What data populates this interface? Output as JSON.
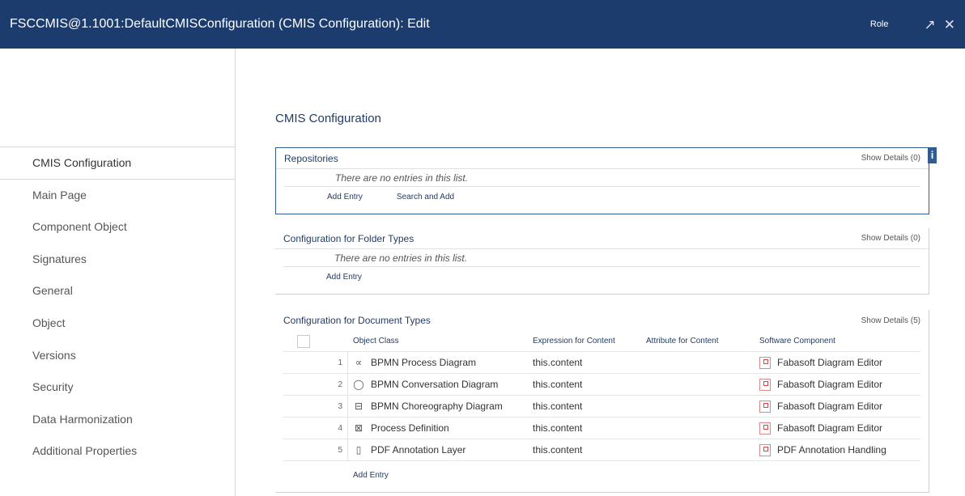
{
  "window": {
    "title": "FSCCMIS@1.1001:DefaultCMISConfiguration (CMIS Configuration): Edit",
    "role_label": "Role",
    "expand_icon": "↗",
    "close_icon": "✕"
  },
  "sidebar": {
    "items": [
      {
        "label": "CMIS Configuration",
        "active": true
      },
      {
        "label": "Main Page"
      },
      {
        "label": "Component Object"
      },
      {
        "label": "Signatures"
      },
      {
        "label": "General"
      },
      {
        "label": "Object"
      },
      {
        "label": "Versions"
      },
      {
        "label": "Security"
      },
      {
        "label": "Data Harmonization"
      },
      {
        "label": "Additional Properties"
      }
    ]
  },
  "main": {
    "page_title": "CMIS Configuration",
    "repositories": {
      "title": "Repositories",
      "details": "Show Details (0)",
      "empty": "There are no entries in this list.",
      "add_entry": "Add Entry",
      "search_add": "Search and Add",
      "info_icon": "i"
    },
    "folder_types": {
      "title": "Configuration for Folder Types",
      "details": "Show Details (0)",
      "empty": "There are no entries in this list.",
      "add_entry": "Add Entry"
    },
    "document_types": {
      "title": "Configuration for Document Types",
      "details": "Show Details (5)",
      "columns": {
        "object_class": "Object Class",
        "expression": "Expression for Content",
        "attribute": "Attribute for Content",
        "software": "Software Component"
      },
      "rows": [
        {
          "num": "1",
          "icon": "∝",
          "object_class": "BPMN Process Diagram",
          "expression": "this.content",
          "attribute": "",
          "software": "Fabasoft Diagram Editor"
        },
        {
          "num": "2",
          "icon": "◯",
          "object_class": "BPMN Conversation Diagram",
          "expression": "this.content",
          "attribute": "",
          "software": "Fabasoft Diagram Editor"
        },
        {
          "num": "3",
          "icon": "⊟",
          "object_class": "BPMN Choreography Diagram",
          "expression": "this.content",
          "attribute": "",
          "software": "Fabasoft Diagram Editor"
        },
        {
          "num": "4",
          "icon": "⊠",
          "object_class": "Process Definition",
          "expression": "this.content",
          "attribute": "",
          "software": "Fabasoft Diagram Editor"
        },
        {
          "num": "5",
          "icon": "▯",
          "object_class": "PDF Annotation Layer",
          "expression": "this.content",
          "attribute": "",
          "software": "PDF Annotation Handling"
        }
      ],
      "add_entry": "Add Entry"
    }
  }
}
